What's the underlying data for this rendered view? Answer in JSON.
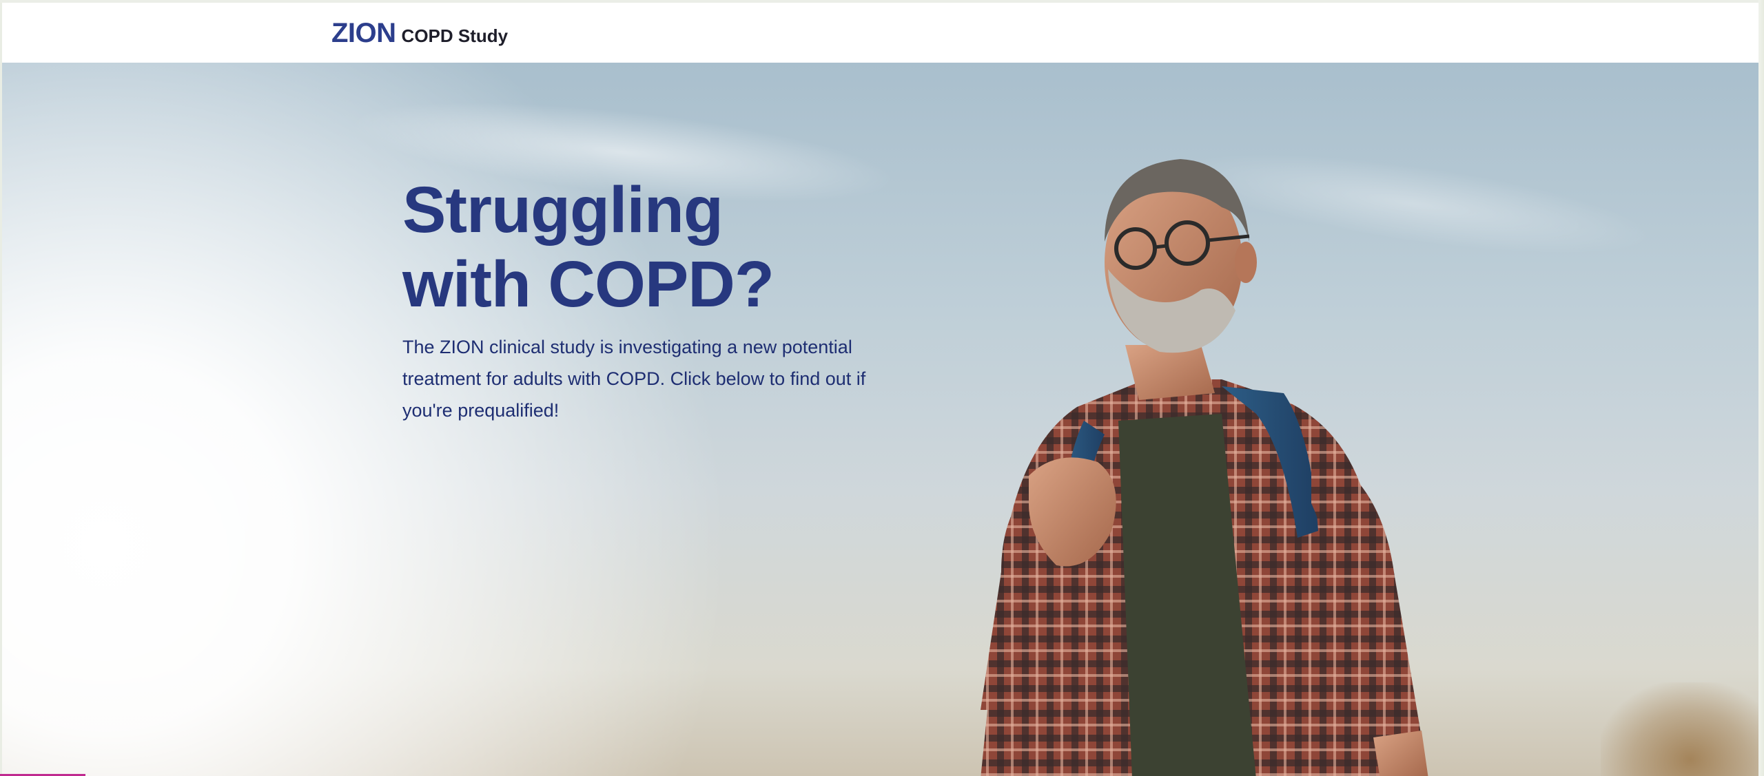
{
  "header": {
    "logo_mark": "ZION",
    "logo_text": "COPD Study"
  },
  "hero": {
    "headline_line_1": "Struggling",
    "headline_line_2": "with COPD?",
    "body": "The ZION clinical study is investigating a new potential treatment for adults with COPD. Click below to find out if you're prequalified!",
    "image": "man-with-backpack-photo"
  },
  "colors": {
    "brand": "#27387f",
    "logo": "#2c3e8c",
    "header_background": "#ffffff",
    "accent": "#c02a8f"
  }
}
